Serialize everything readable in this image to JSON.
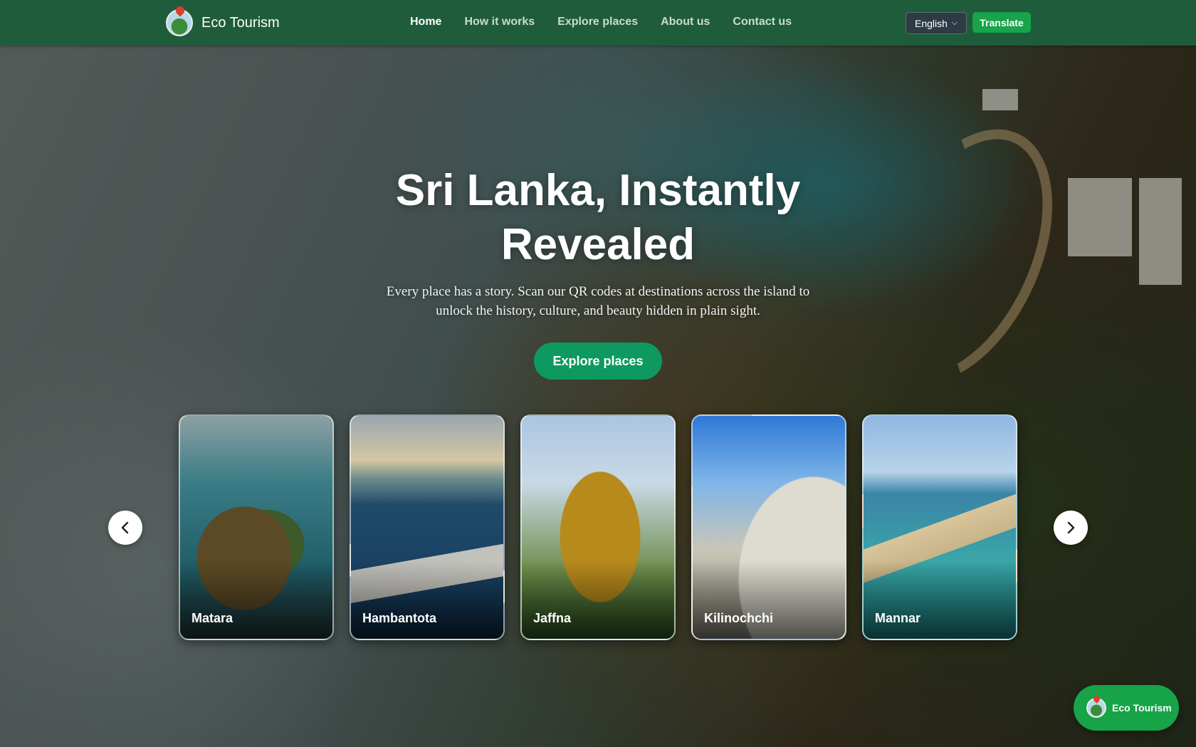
{
  "nav": {
    "brand": "Eco Tourism",
    "links": [
      "Home",
      "How it works",
      "Explore places",
      "About us",
      "Contact us"
    ],
    "active_link": "Home",
    "language": "English",
    "translate_label": "Translate"
  },
  "hero": {
    "title_line1": "Sri Lanka, Instantly",
    "title_line2": "Revealed",
    "subtitle_line1": "Every place has a story. Scan our QR codes at destinations across the island to",
    "subtitle_line2": "unlock the history, culture, and beauty hidden in plain sight.",
    "cta_label": "Explore places"
  },
  "places": [
    "Matara",
    "Hambantota",
    "Jaffna",
    "Kilinochchi",
    "Mannar"
  ],
  "widget": {
    "label": "Eco Tourism"
  },
  "colors": {
    "nav_bg": "#1f5c3c",
    "cta": "#0d9960",
    "translate": "#19a34a"
  },
  "icons": {
    "prev": "chevron-left-icon",
    "next": "chevron-right-icon",
    "logo": "eco-tourism-logo-icon"
  }
}
